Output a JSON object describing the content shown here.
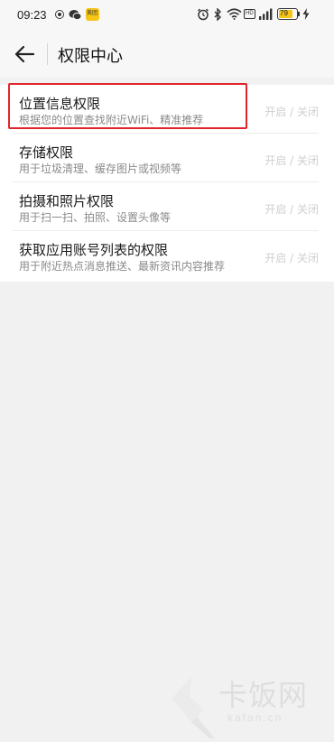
{
  "status_bar": {
    "time": "09:23",
    "battery_level": "79",
    "icons": [
      "app-badge-icon",
      "wechat-icon",
      "meituan-app-icon",
      "alarm-icon",
      "bluetooth-icon",
      "wifi-icon",
      "hd-icon",
      "signal-icon",
      "battery-icon",
      "charging-icon"
    ],
    "meituan_label": "美团",
    "hd_label": "HD"
  },
  "header": {
    "title": "权限中心"
  },
  "permissions": [
    {
      "name": "位置信息权限",
      "desc": "根据您的位置查找附近WiFi、精准推荐",
      "toggle": "开启 / 关闭"
    },
    {
      "name": "存储权限",
      "desc": "用于垃圾清理、缓存图片或视频等",
      "toggle": "开启 / 关闭"
    },
    {
      "name": "拍摄和照片权限",
      "desc": "用于扫一扫、拍照、设置头像等",
      "toggle": "开启 / 关闭"
    },
    {
      "name": "获取应用账号列表的权限",
      "desc": "用于附近热点消息推送、最新资讯内容推荐",
      "toggle": "开启 / 关闭"
    }
  ],
  "watermark": {
    "text": "卡饭网",
    "url": "kafan.cn"
  },
  "colors": {
    "highlight_border": "#e0262b",
    "background": "#f1f1f1"
  }
}
